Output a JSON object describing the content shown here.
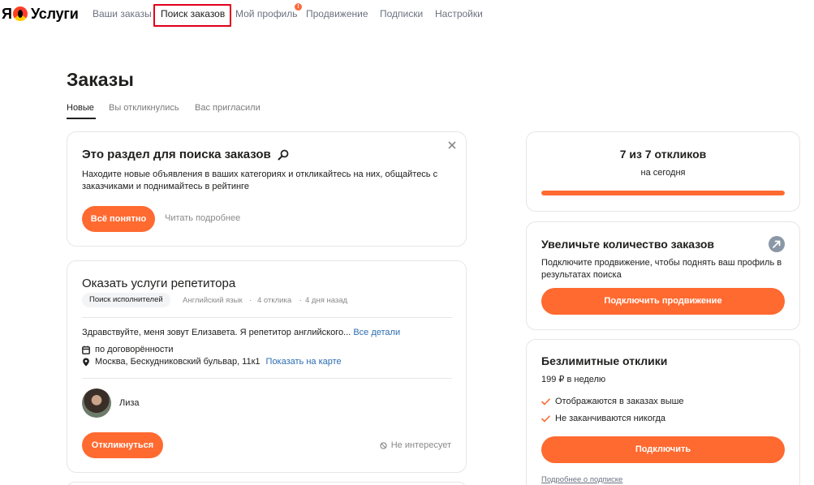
{
  "header": {
    "logo_ya": "Я",
    "logo_text": "Услуги",
    "nav": [
      {
        "label": "Ваши заказы"
      },
      {
        "label": "Поиск заказов"
      },
      {
        "label": "Мой профиль",
        "badge": "!"
      },
      {
        "label": "Продвижение"
      },
      {
        "label": "Подписки"
      },
      {
        "label": "Настройки"
      }
    ]
  },
  "page": {
    "title": "Заказы",
    "tabs": [
      {
        "label": "Новые"
      },
      {
        "label": "Вы откликнулись"
      },
      {
        "label": "Вас пригласили"
      }
    ]
  },
  "info_card": {
    "title": "Это раздел для поиска заказов",
    "text": "Находите новые объявления в ваших категориях и откликайтесь на них, общайтесь с заказчиками и поднимайтесь в рейтинге",
    "button": "Всё понятно",
    "link": "Читать подробнее"
  },
  "order": {
    "title": "Оказать услуги репетитора",
    "tag": "Поиск исполнителей",
    "category": "Английский язык",
    "responses": "4 отклика",
    "posted": "4 дня назад",
    "description": "Здравствуйте, меня зовут Елизавета. Я репетитор английского...",
    "details_link": "Все детали",
    "price": "по договорённости",
    "address": "Москва, Бескудниковский бульвар, 11к1",
    "map_link": "Показать на карте",
    "client_name": "Лиза",
    "respond_button": "Откликнуться",
    "not_interested": "Не интересует"
  },
  "responses_card": {
    "title": "7 из 7 откликов",
    "subtitle": "на сегодня",
    "progress": 1.0
  },
  "promo_card": {
    "title": "Увеличьте количество заказов",
    "text": "Подключите продвижение, чтобы поднять ваш профиль в результатах поиска",
    "button": "Подключить продвижение"
  },
  "unlimited_card": {
    "title": "Безлимитные отклики",
    "price": "199 ₽ в неделю",
    "features": [
      "Отображаются в заказах выше",
      "Не заканчиваются никогда"
    ],
    "button": "Подключить",
    "link": "Подробнее о подписке"
  },
  "colors": {
    "accent": "#ff6a30",
    "link": "#2b6cb0",
    "active_outline": "#e0001b"
  }
}
